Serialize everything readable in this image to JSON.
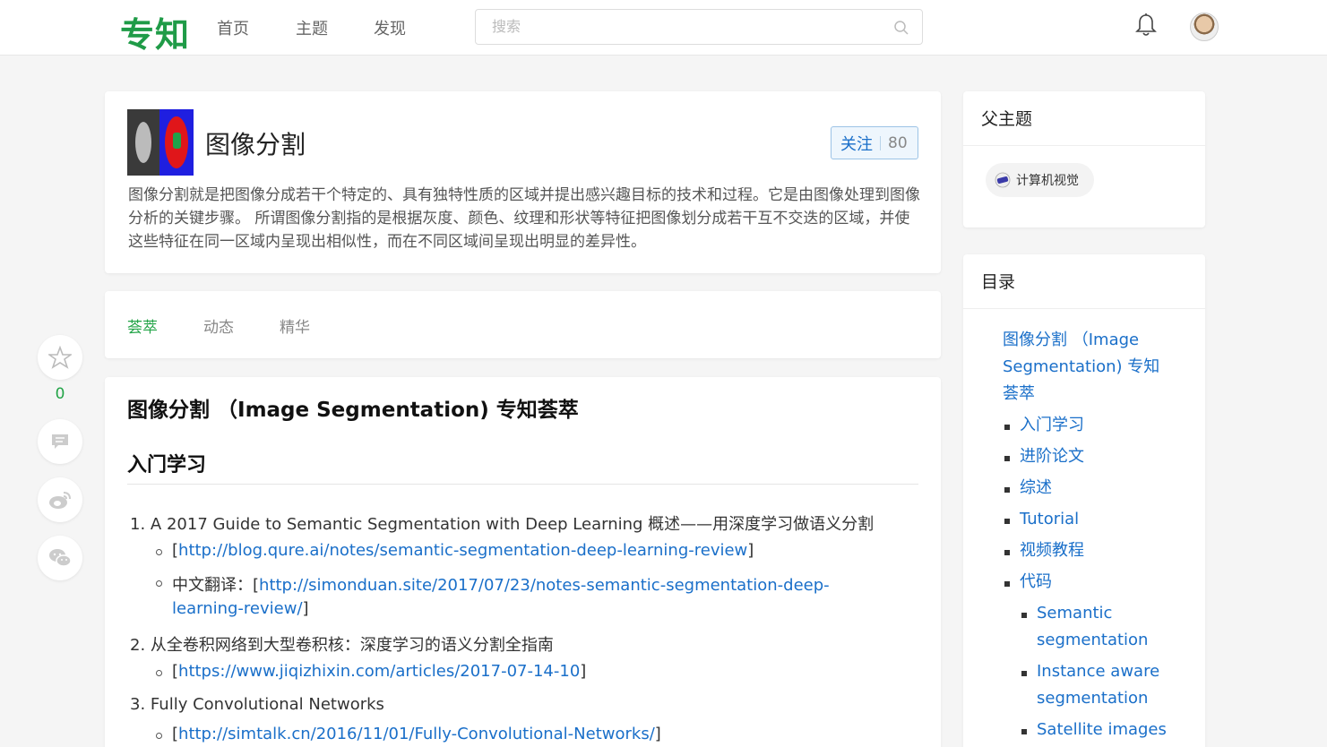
{
  "nav": {
    "logo": "专知",
    "logo_color": "#1f9b47",
    "links": [
      "首页",
      "主题",
      "发现"
    ],
    "search_placeholder": "搜索"
  },
  "topic": {
    "title": "图像分割",
    "follow_label": "关注",
    "follow_count": "80",
    "description": "图像分割就是把图像分成若干个特定的、具有独特性质的区域并提出感兴趣目标的技术和过程。它是由图像处理到图像分析的关键步骤。 所谓图像分割指的是根据灰度、颜色、纹理和形状等特征把图像划分成若干互不交迭的区域，并使这些特征在同一区域内呈现出相似性，而在不同区域间呈现出明显的差异性。"
  },
  "tabs": [
    "荟萃",
    "动态",
    "精华"
  ],
  "side": {
    "star_count": "0"
  },
  "content": {
    "title": "图像分割 （Image Segmentation) 专知荟萃",
    "section": "入门学习",
    "items": [
      {
        "num": "1.",
        "text": "A 2017 Guide to Semantic Segmentation with Deep Learning 概述——用深度学习做语义分割",
        "sub": [
          {
            "prefix": "",
            "link": "http://blog.qure.ai/notes/semantic-segmentation-deep-learning-review"
          },
          {
            "prefix": "中文翻译：",
            "link": "http://simonduan.site/2017/07/23/notes-semantic-segmentation-deep-",
            "link_cont": "learning-review/"
          }
        ]
      },
      {
        "num": "2.",
        "text": "从全卷积网络到大型卷积核：深度学习的语义分割全指南",
        "sub": [
          {
            "prefix": "",
            "link": "https://www.jiqizhixin.com/articles/2017-07-14-10"
          }
        ]
      },
      {
        "num": "3.",
        "text": "Fully Convolutional Networks",
        "sub": [
          {
            "prefix": "",
            "link": "http://simtalk.cn/2016/11/01/Fully-Convolutional-Networks/"
          }
        ]
      }
    ]
  },
  "parent_topics": {
    "heading": "父主题",
    "chip": "计算机视觉"
  },
  "toc": {
    "heading": "目录",
    "root": [
      "图像分割 （Image",
      "Segmentation) 专知",
      "荟萃"
    ],
    "items": [
      "入门学习",
      "进阶论文",
      "综述",
      "Tutorial",
      "视频教程",
      "代码"
    ],
    "sub_items": [
      [
        "Semantic",
        "segmentation"
      ],
      [
        "Instance aware",
        "segmentation"
      ],
      [
        "Satellite images"
      ]
    ]
  }
}
